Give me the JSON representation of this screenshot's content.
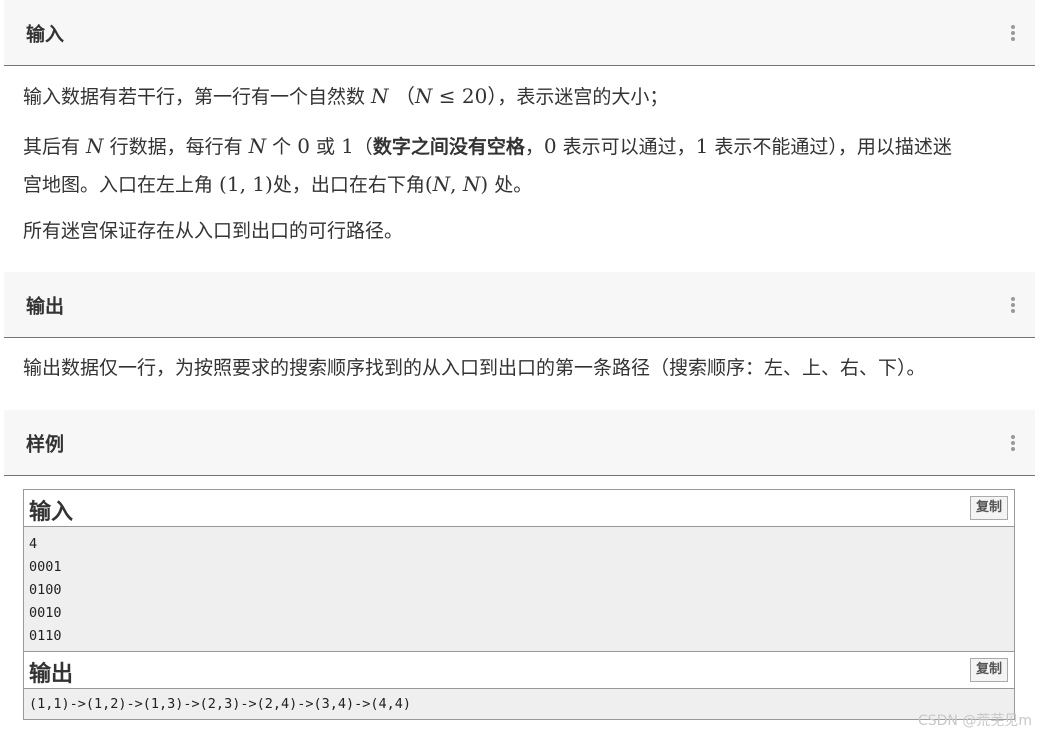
{
  "input_section": {
    "title": "输入",
    "p1_a": "输入数据有若干行，第一行有一个自然数 ",
    "p1_math": "N （N ≤ 20）",
    "p1_b": "，表示迷宫的大小；",
    "p2_a": "其后有 ",
    "p2_N1": "N",
    "p2_b": " 行数据，每行有 ",
    "p2_N2": "N",
    "p2_c": " 个 ",
    "p2_zero": "0",
    "p2_d": " 或 ",
    "p2_one": "1",
    "p2_e": "（",
    "p2_bold": "数字之间没有空格",
    "p2_f": "，",
    "p2_zero2": "0",
    "p2_g": " 表示可以通过，",
    "p2_one2": "1",
    "p2_h": " 表示不能通过），用以描述迷",
    "p2_line2_a": "宫地图。入口在左上角 ",
    "p2_entry": "(1, 1)",
    "p2_line2_b": "处，出口在右下角",
    "p2_exit": "(N, N)",
    "p2_line2_c": " 处。",
    "p3": "所有迷宫保证存在从入口到出口的可行路径。"
  },
  "output_section": {
    "title": "输出",
    "p1": "输出数据仅一行，为按照要求的搜索顺序找到的从入口到出口的第一条路径（搜索顺序：左、上、右、下）。"
  },
  "sample_section": {
    "title": "样例",
    "input_title": "输入",
    "input_copy": "复制",
    "input_lines": [
      "4",
      "0001",
      "0100",
      "0010",
      "0110"
    ],
    "output_title": "输出",
    "output_copy": "复制",
    "output_lines": [
      "(1,1)->(1,2)->(1,3)->(2,3)->(2,4)->(3,4)->(4,4)"
    ]
  },
  "watermark": "CSDN @荒芜见m"
}
